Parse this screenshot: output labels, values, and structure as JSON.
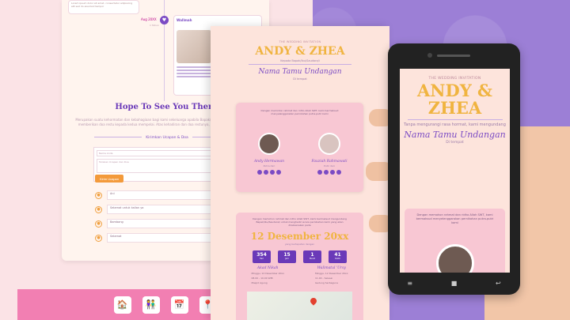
{
  "left_page": {
    "story_date": "Aug 20XX",
    "story_time": "1 Tahun",
    "story_title": "Wallmah",
    "hope_title": "Hope To See You There",
    "hope_text": "Merupakan suatu kehormatan dan kebahagiaan bagi kami sekeluarga apabila Bapak/Ibu/Saudara/i berkenan hadir memberikan doa restu kepada kedua mempelai. Atas kehadiran dan doa restunya, kami ucapkan terima kasih.",
    "form_label": "Kirimkan Ucapan & Doa",
    "name_placeholder": "Nama Anda",
    "message_placeholder": "Tuliskan Ucapan dan Doa",
    "submit_label": "Kirim Ucapan",
    "comments": [
      "Ani",
      "Selamat untuk kalian ya",
      "Bambang",
      "Selamat"
    ]
  },
  "middle_page": {
    "wedding_label": "THE WEDDING INVITATION",
    "couple_names": "ANDY & ZHEA",
    "subtitle": "Kepada Bapak/Ibu/Saudara/i",
    "invitee": "Nama Tamu Undangan",
    "invitee_role": "Di tempat",
    "quote": "Dengan memohon rahmat dan ridho Allah SWT, kami bermaksud menyelenggarakan pernikahan putra-putri kami",
    "groom_name": "Andy Hermawan",
    "groom_role": "Putra dari",
    "bride_name": "Fauziah Rahmawati",
    "bride_role": "Putri dari",
    "event_quote": "Dengan memohon rahmat dan ridho Allah SWT, kami bermaksud mengundang Bapak/Ibu/Saudara/i untuk menghadiri acara pernikahan kami yang akan dilaksanakan pada",
    "event_date": "12 Desember 20xx",
    "event_sub": "yang bertepatan dengan",
    "countdown": [
      {
        "value": "354",
        "label": "Hari"
      },
      {
        "value": "15",
        "label": "Jam"
      },
      {
        "value": "1",
        "label": "Menit"
      },
      {
        "value": "41",
        "label": "Detik"
      }
    ],
    "akad_title": "Akad Nikah",
    "resepsi_title": "Walimatul 'Ursy",
    "akad_lines": [
      "Minggu, 12 Desember 20xx",
      "08.00 - 10.00 WIB",
      "Masjid Agung"
    ],
    "resepsi_lines": [
      "Minggu, 12 Desember 20xx",
      "11.00 - Selesai",
      "Gedung Serbaguna"
    ]
  },
  "phone": {
    "wedding_label": "THE WEDDING INVITATION",
    "couple_names": "ANDY & ZHEA",
    "subtitle": "Tanpa mengurangi rasa hormat, kami mengundang",
    "invitee": "Nama Tamu Undangan",
    "invitee_role": "Di tempat",
    "quote": "Dengan memohon rahmat dan ridho Allah SWT, kami bermaksud menyelenggarakan pernikahan putra-putri kami"
  }
}
